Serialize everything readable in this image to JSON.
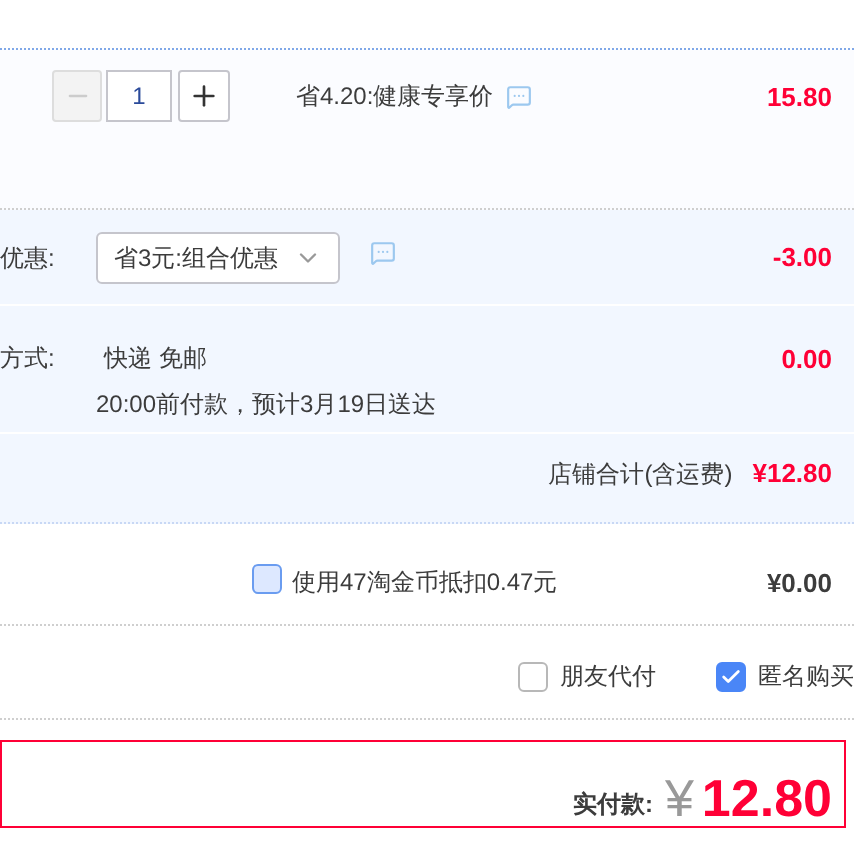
{
  "item": {
    "quantity": "1",
    "minus_disabled": true,
    "promo": "省4.20:健康专享价",
    "price": "15.80"
  },
  "discount": {
    "label": "优惠:",
    "selected_option": "省3元:组合优惠",
    "amount": "-3.00"
  },
  "shipping": {
    "label": "方式:",
    "method": "快递 免邮",
    "eta": "20:00前付款，预计3月19日送达",
    "amount": "0.00"
  },
  "store_total": {
    "label": "店铺合计(含运费)",
    "amount": "¥12.80"
  },
  "coins": {
    "label": "使用47淘金币抵扣0.47元",
    "checked": false,
    "amount": "¥0.00"
  },
  "options": [
    {
      "label": "朋友代付",
      "checked": false
    },
    {
      "label": "匿名购买",
      "checked": true
    }
  ],
  "pay": {
    "label": "实付款:",
    "currency": "¥",
    "amount": "12.80"
  }
}
